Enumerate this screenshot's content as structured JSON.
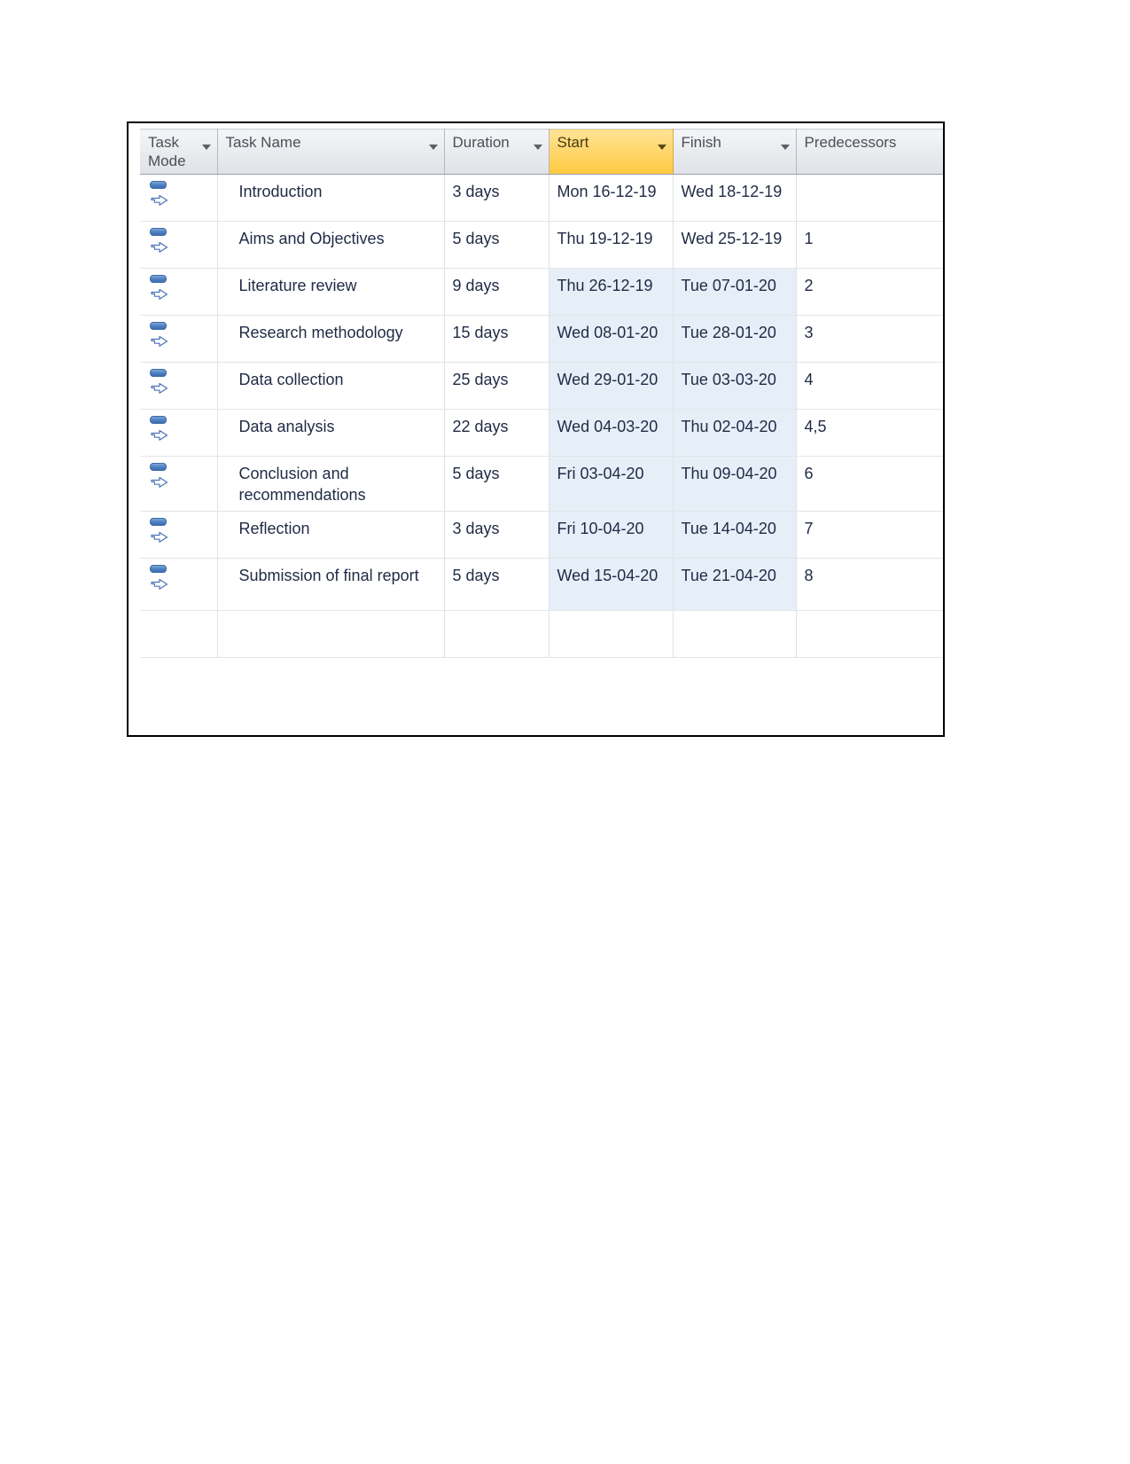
{
  "app": {
    "view_name": "project-schedule-entry-table",
    "accent_selected_header": "#FFD76E",
    "highlight_cell_color": "#E6EFF8",
    "text_color": "#1F2A44",
    "header_text_color": "#4B4F57"
  },
  "table": {
    "columns": [
      {
        "key": "task_mode",
        "label": "Task Mode",
        "selected": false,
        "has_filter": true
      },
      {
        "key": "task_name",
        "label": "Task Name",
        "selected": false,
        "has_filter": true
      },
      {
        "key": "duration",
        "label": "Duration",
        "selected": false,
        "has_filter": true
      },
      {
        "key": "start",
        "label": "Start",
        "selected": true,
        "has_filter": true
      },
      {
        "key": "finish",
        "label": "Finish",
        "selected": false,
        "has_filter": true
      },
      {
        "key": "predecessors",
        "label": "Predecessors",
        "selected": false,
        "has_filter": true
      }
    ],
    "task_mode_icon": "auto-scheduled-icon",
    "rows": [
      {
        "task_mode": "auto-scheduled-icon",
        "task_name": "Introduction",
        "duration": "3 days",
        "start": "Mon 16-12-19",
        "finish": "Wed 18-12-19",
        "predecessors": "",
        "highlighted": false,
        "two_line": false
      },
      {
        "task_mode": "auto-scheduled-icon",
        "task_name": "Aims and Objectives",
        "duration": "5 days",
        "start": "Thu 19-12-19",
        "finish": "Wed 25-12-19",
        "predecessors": "1",
        "highlighted": false,
        "two_line": false
      },
      {
        "task_mode": "auto-scheduled-icon",
        "task_name": "Literature review",
        "duration": "9 days",
        "start": "Thu 26-12-19",
        "finish": "Tue 07-01-20",
        "predecessors": "2",
        "highlighted": true,
        "two_line": false
      },
      {
        "task_mode": "auto-scheduled-icon",
        "task_name": "Research methodology",
        "duration": "15 days",
        "start": "Wed 08-01-20",
        "finish": "Tue 28-01-20",
        "predecessors": "3",
        "highlighted": true,
        "two_line": false
      },
      {
        "task_mode": "auto-scheduled-icon",
        "task_name": "Data collection",
        "duration": "25 days",
        "start": "Wed 29-01-20",
        "finish": "Tue 03-03-20",
        "predecessors": "4",
        "highlighted": true,
        "two_line": false
      },
      {
        "task_mode": "auto-scheduled-icon",
        "task_name": "Data analysis",
        "duration": "22 days",
        "start": "Wed 04-03-20",
        "finish": "Thu 02-04-20",
        "predecessors": "4,5",
        "highlighted": true,
        "two_line": false
      },
      {
        "task_mode": "auto-scheduled-icon",
        "task_name": "Conclusion and recommendations",
        "duration": "5 days",
        "start": "Fri 03-04-20",
        "finish": "Thu 09-04-20",
        "predecessors": "6",
        "highlighted": true,
        "two_line": true
      },
      {
        "task_mode": "auto-scheduled-icon",
        "task_name": "Reflection",
        "duration": "3 days",
        "start": "Fri 10-04-20",
        "finish": "Tue 14-04-20",
        "predecessors": "7",
        "highlighted": true,
        "two_line": false
      },
      {
        "task_mode": "auto-scheduled-icon",
        "task_name": "Submission of final report",
        "duration": "5 days",
        "start": "Wed 15-04-20",
        "finish": "Tue 21-04-20",
        "predecessors": "8",
        "highlighted": true,
        "two_line": true
      }
    ]
  }
}
